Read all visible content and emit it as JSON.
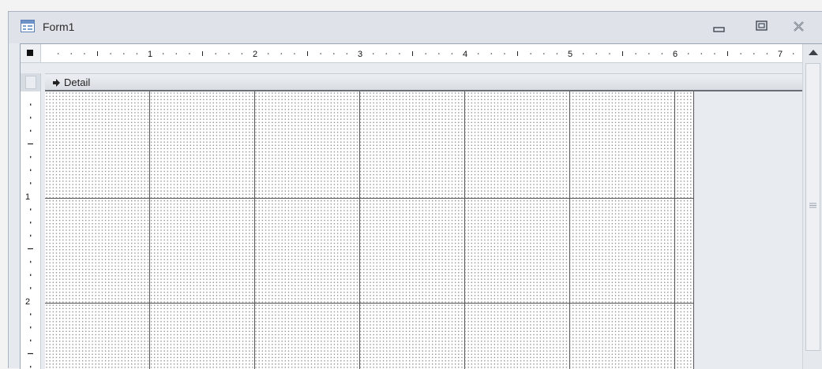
{
  "window": {
    "title": "Form1",
    "icon": "form-icon",
    "controls": [
      "minimize-icon",
      "maximize-icon",
      "close-icon"
    ]
  },
  "ruler": {
    "horizontal_numbers": [
      "1",
      "2",
      "3",
      "4",
      "5",
      "6",
      "7"
    ],
    "vertical_numbers": [
      "1",
      "2"
    ]
  },
  "section": {
    "label": "Detail",
    "icon": "section-arrow-icon"
  },
  "colors": {
    "titlebar": "#dfe3e9",
    "workspace": "#e8ebf0",
    "grid_dots": "#8f8f8f",
    "grid_lines": "#555555",
    "section_underline": "#6a6f76"
  }
}
